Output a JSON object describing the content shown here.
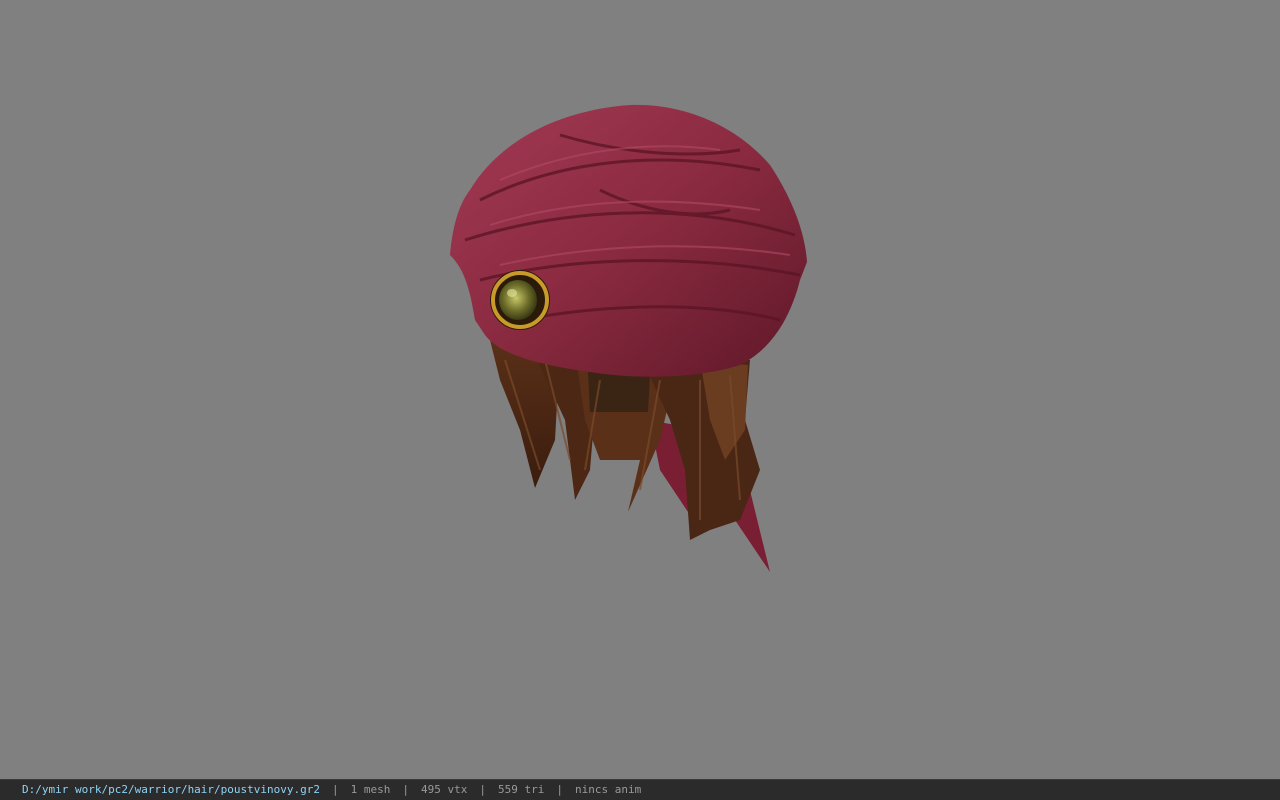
{
  "viewer": {
    "background_color": "#808080",
    "model_name": "poustvinovy",
    "model_colors": {
      "turban": "#8a2a40",
      "turban_shadow": "#5a1424",
      "hair": "#4a2614",
      "hair_light": "#7a4a2a",
      "gem": "#9a9a3a",
      "gem_rim": "#c89a2a"
    }
  },
  "statusbar": {
    "path": "D:/ymir work/pc2/warrior/hair/poustvinovy.gr2",
    "separator": "|",
    "mesh": "1 mesh",
    "vertices": "495 vtx",
    "triangles": "559 tri",
    "anim": "nincs anim"
  }
}
